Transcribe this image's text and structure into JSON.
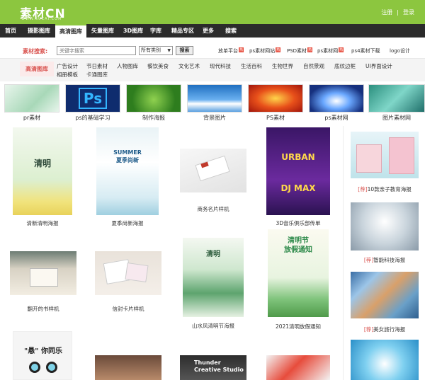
{
  "header": {
    "logo": "素材CN",
    "logo_sub": "WWW.SUCAI.COM",
    "links": [
      "注册",
      "登录"
    ],
    "link_sep": "|"
  },
  "nav": {
    "items": [
      "首页",
      "摄影图库",
      "高清图库",
      "矢量图库",
      "3D图库",
      "字库",
      "精品专区",
      "更多",
      "搜索"
    ],
    "active_index": 2
  },
  "search": {
    "label": "素材搜索:",
    "placeholder": "关键字搜索",
    "select_value": "所有类别",
    "button": "搜索",
    "hot_links": [
      "放单平台",
      "ps素材网站",
      "PSD素材",
      "ps素材网",
      "ps4素材下载",
      "logo设计"
    ],
    "hot_badge": "热"
  },
  "categories": {
    "label": "高清图库",
    "row1": [
      "广告设计",
      "节日素材",
      "人物图库",
      "餐饮美食",
      "文化艺术",
      "现代科技",
      "生活百科",
      "生物世界",
      "自然景观",
      "底纹边框",
      "UI界面设计"
    ],
    "row2": [
      "相册模板",
      "卡通图库"
    ]
  },
  "thumbs": [
    {
      "caption": "pr素材",
      "color": "#cfe7d6"
    },
    {
      "caption": "ps的基础学习",
      "color": "#1a3f8f",
      "overlay": "Ps"
    },
    {
      "caption": "制作海报",
      "color": "#4c9a2e"
    },
    {
      "caption": "背景图片",
      "color": "#3b86c9"
    },
    {
      "caption": "PS素材",
      "color": "#c93a1e"
    },
    {
      "caption": "ps素材网",
      "color": "#1e3a9a"
    },
    {
      "caption": "图片素材网",
      "color": "#3a9a8a"
    }
  ],
  "cards": [
    {
      "caption": "清新清明海报",
      "overlay": "清明"
    },
    {
      "caption": "夏季尚新海报",
      "overlay": "SUMMER\n夏季尚新"
    },
    {
      "caption": "商务名片样机"
    },
    {
      "caption": "3D音乐俱乐部传单",
      "overlay": "URBAN\nDJ MAX"
    },
    {
      "caption": "翻开的书样机"
    },
    {
      "caption": "信封卡片样机"
    },
    {
      "caption": "山水风清明节海报",
      "overlay": "清明"
    },
    {
      "caption": "2021清明放假通知",
      "overlay": "清明节\n放假通知"
    },
    {
      "caption": "",
      "overlay": "\"悬\" 你同乐"
    },
    {
      "caption": ""
    },
    {
      "caption": "",
      "overlay": "Thunder\nCreative Studio"
    },
    {
      "caption": ""
    }
  ],
  "sidebar": {
    "tag": "[荐]",
    "items": [
      {
        "caption": "10款亲子教育海报"
      },
      {
        "caption": "智能科技海报"
      },
      {
        "caption": "美女旅行海报"
      },
      {
        "caption": ""
      }
    ]
  },
  "colors": {
    "brand": "#8cc63f",
    "nav_bg": "#2b2b2b",
    "accent_red": "#d9534f"
  }
}
